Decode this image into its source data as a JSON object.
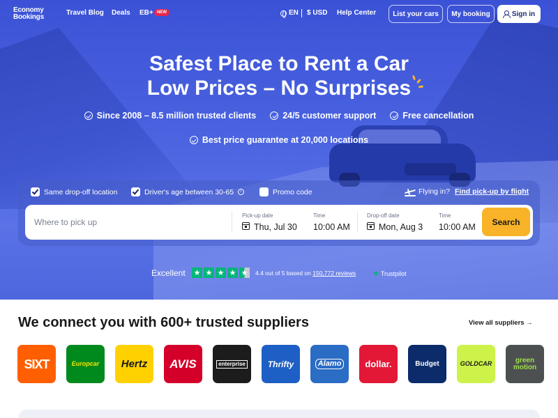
{
  "nav": {
    "logo": {
      "line1": "Economy",
      "line2": "Bookings"
    },
    "travel_blog": "Travel Blog",
    "deals": "Deals",
    "eb_plus": "EB+",
    "new_badge": "NEW",
    "language": "EN",
    "currency": "$ USD",
    "help": "Help Center",
    "list_cars": "List your cars",
    "my_booking": "My booking",
    "sign_in": "Sign in"
  },
  "hero": {
    "title_line1": "Safest Place to Rent a Car",
    "title_line2": "Low Prices – No Surprises",
    "benefits": [
      "Since 2008 – 8.5 million trusted clients",
      "24/5 customer support",
      "Free cancellation",
      "Best price guarantee at 20,000 locations"
    ]
  },
  "search": {
    "options": [
      {
        "label": "Same drop-off location",
        "checked": true
      },
      {
        "label": "Driver's age between 30-65",
        "checked": true,
        "info_icon": "info-icon"
      },
      {
        "label": "Promo code",
        "checked": false
      }
    ],
    "flying_in": "Flying in?",
    "flight_link": "Find pick-up by flight",
    "where_placeholder": "Where to pick up",
    "pickup_date_label": "Pick-up date",
    "pickup_date": "Thu, Jul 30",
    "pickup_time_label": "Time",
    "pickup_time": "10:00 AM",
    "dropoff_date_label": "Drop-off date",
    "dropoff_date": "Mon, Aug 3",
    "dropoff_time_label": "Time",
    "dropoff_time": "10:00 AM",
    "button": "Search"
  },
  "trustpilot": {
    "rating_word": "Excellent",
    "stars": 4.5,
    "text_prefix": "4.4 out of 5 based on",
    "reviews": "150,772 reviews",
    "brand": "Trustpilot"
  },
  "suppliers": {
    "title": "We connect you with 600+ trusted suppliers",
    "view_all": "View all suppliers →",
    "logos": [
      {
        "name": "SIXT",
        "bg": "#ff5f00",
        "fg": "#ffffff"
      },
      {
        "name": "Europcar",
        "bg": "#008a1e",
        "fg": "#f5e400"
      },
      {
        "name": "Hertz",
        "bg": "#ffd100",
        "fg": "#1a1a1a"
      },
      {
        "name": "AVIS",
        "bg": "#d4002a",
        "fg": "#ffffff"
      },
      {
        "name": "enterprise",
        "bg": "#1c1c1c",
        "fg": "#ffffff"
      },
      {
        "name": "Thrifty",
        "bg": "#1d5fc4",
        "fg": "#ffffff"
      },
      {
        "name": "Alamo",
        "bg": "#2b6cc4",
        "fg": "#ffffff"
      },
      {
        "name": "dollar.",
        "bg": "#e31837",
        "fg": "#ffffff"
      },
      {
        "name": "Budget",
        "bg": "#0b2b6b",
        "fg": "#ffffff"
      },
      {
        "name": "GOLDCAR",
        "bg": "#cdf24a",
        "fg": "#1a1a1a"
      },
      {
        "name": "green motion",
        "bg": "#4d5050",
        "fg": "#9fe04c"
      }
    ]
  }
}
